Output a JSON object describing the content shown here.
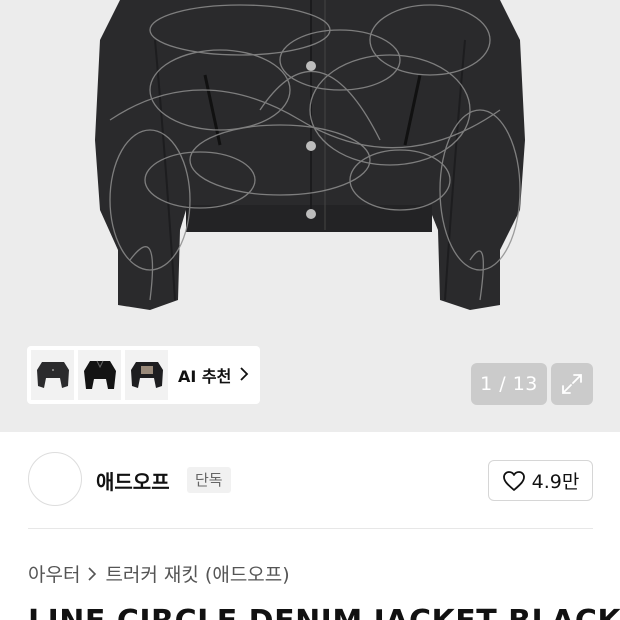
{
  "gallery": {
    "counter": "1 / 13",
    "ai_label": "AI 추천",
    "thumbnails": [
      "jacket-front-thumb",
      "jacket-dark-thumb",
      "jacket-back-thumb"
    ]
  },
  "brand": {
    "name": "애드오프",
    "badge": "단독",
    "likes": "4.9만"
  },
  "breadcrumb": {
    "items": [
      "아우터",
      "트러커 재킷 (애드오프)"
    ]
  },
  "product": {
    "title": "LINE CIRCLE DENIM JACKET BLACK"
  },
  "colors": {
    "hero_bg": "#ececec",
    "jacket": "#2a2a2c",
    "accent_text": "#111111"
  },
  "icons": [
    "chevron-right-icon",
    "expand-icon",
    "heart-icon"
  ]
}
